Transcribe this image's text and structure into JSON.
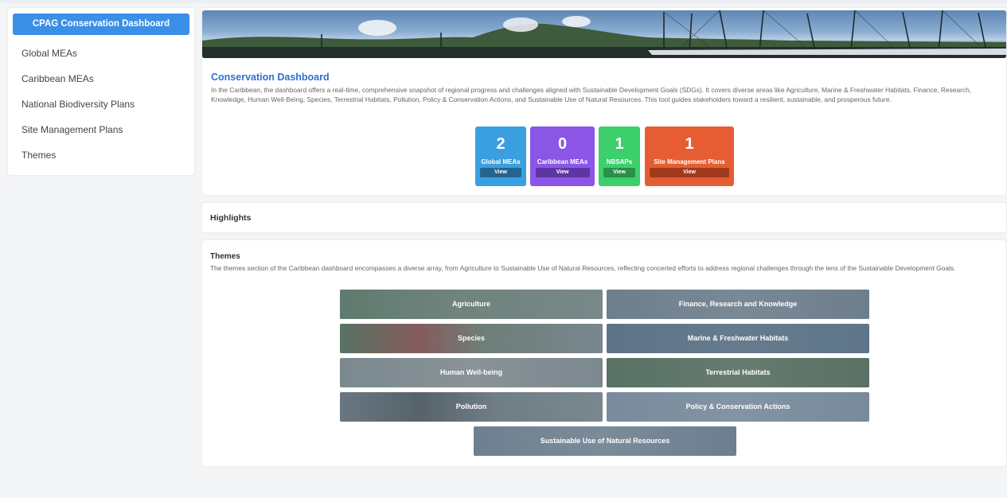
{
  "sidebar": {
    "title": "CPAG Conservation Dashboard",
    "items": [
      {
        "label": "Global MEAs"
      },
      {
        "label": "Caribbean MEAs"
      },
      {
        "label": "National Biodiversity Plans"
      },
      {
        "label": "Site Management Plans"
      },
      {
        "label": "Themes"
      }
    ]
  },
  "intro": {
    "title": "Conservation Dashboard",
    "text": "In the Caribbean, the dashboard offers a real-time, comprehensive snapshot of regional progress and challenges aligned with Sustainable Development Goals (SDGs). It covers diverse areas like Agriculture, Marine & Freshwater Habitats, Finance, Research, Knowledge, Human Well-Being, Species, Terrestrial Habitats, Pollution, Policy & Conservation Actions, and Sustainable Use of Natural Resources. This tool guides stakeholders toward a resilient, sustainable, and prosperous future."
  },
  "stats": [
    {
      "value": "2",
      "label": "Global MEAs",
      "button": "View",
      "color": "#3a9fe0"
    },
    {
      "value": "0",
      "label": "Caribbean MEAs",
      "button": "View",
      "color": "#8b56e6"
    },
    {
      "value": "1",
      "label": "NBSAPs",
      "button": "View",
      "color": "#3ccf6b"
    },
    {
      "value": "1",
      "label": "Site Management Plans",
      "button": "View",
      "color": "#e65d33"
    }
  ],
  "highlights": {
    "title": "Highlights"
  },
  "themes": {
    "title": "Themes",
    "text": "The themes section of the Caribbean dashboard encompasses a diverse array, from Agriculture to Sustainable Use of Natural Resources, reflecting concerted efforts to address regional challenges through the lens of the Sustainable Development Goals.",
    "items": [
      {
        "label": "Agriculture"
      },
      {
        "label": "Finance, Research and Knowledge"
      },
      {
        "label": "Species"
      },
      {
        "label": "Marine & Freshwater Habitats"
      },
      {
        "label": "Human Well-being"
      },
      {
        "label": "Terrestrial Habitats"
      },
      {
        "label": "Pollution"
      },
      {
        "label": "Policy & Conservation Actions"
      },
      {
        "label": "Sustainable Use of Natural Resources"
      }
    ]
  },
  "colors": {
    "accent": "#3b8fe6",
    "title_blue": "#2f6fd0"
  }
}
